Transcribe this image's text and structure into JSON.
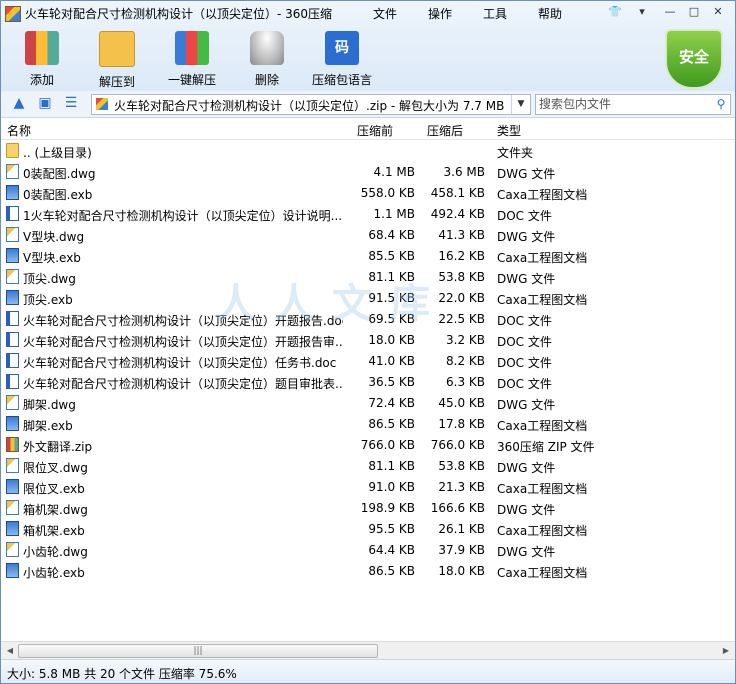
{
  "window": {
    "title": "火车轮对配合尺寸检测机构设计（以顶尖定位）- 360压缩",
    "menu": [
      "文件",
      "操作",
      "工具",
      "帮助"
    ]
  },
  "toolbar": {
    "add_label": "添加",
    "extract_label": "解压到",
    "one_click_label": "一键解压",
    "delete_label": "删除",
    "lang_label": "压缩包语言",
    "lang_glyph": "码"
  },
  "security_label": "安全",
  "navbar": {
    "path": "火车轮对配合尺寸检测机构设计（以顶尖定位）.zip - 解包大小为 7.7 MB",
    "search_placeholder": "搜索包内文件"
  },
  "columns": {
    "name": "名称",
    "compressed": "压缩前",
    "packed": "压缩后",
    "type": "类型"
  },
  "files": [
    {
      "name": ".. (上级目录)",
      "size": "",
      "packed": "",
      "type": "文件夹",
      "icon": "folder"
    },
    {
      "name": "0装配图.dwg",
      "size": "4.1 MB",
      "packed": "3.6 MB",
      "type": "DWG 文件",
      "icon": "dwg"
    },
    {
      "name": "0装配图.exb",
      "size": "558.0 KB",
      "packed": "458.1 KB",
      "type": "Caxa工程图文档",
      "icon": "exb"
    },
    {
      "name": "1火车轮对配合尺寸检测机构设计（以顶尖定位）设计说明...",
      "size": "1.1 MB",
      "packed": "492.4 KB",
      "type": "DOC 文件",
      "icon": "doc"
    },
    {
      "name": "V型块.dwg",
      "size": "68.4 KB",
      "packed": "41.3 KB",
      "type": "DWG 文件",
      "icon": "dwg"
    },
    {
      "name": "V型块.exb",
      "size": "85.5 KB",
      "packed": "16.2 KB",
      "type": "Caxa工程图文档",
      "icon": "exb"
    },
    {
      "name": "顶尖.dwg",
      "size": "81.1 KB",
      "packed": "53.8 KB",
      "type": "DWG 文件",
      "icon": "dwg"
    },
    {
      "name": "顶尖.exb",
      "size": "91.5 KB",
      "packed": "22.0 KB",
      "type": "Caxa工程图文档",
      "icon": "exb"
    },
    {
      "name": "火车轮对配合尺寸检测机构设计（以顶尖定位）开题报告.doc",
      "size": "69.5 KB",
      "packed": "22.5 KB",
      "type": "DOC 文件",
      "icon": "doc"
    },
    {
      "name": "火车轮对配合尺寸检测机构设计（以顶尖定位）开题报告审...",
      "size": "18.0 KB",
      "packed": "3.2 KB",
      "type": "DOC 文件",
      "icon": "doc"
    },
    {
      "name": "火车轮对配合尺寸检测机构设计（以顶尖定位）任务书.doc",
      "size": "41.0 KB",
      "packed": "8.2 KB",
      "type": "DOC 文件",
      "icon": "doc"
    },
    {
      "name": "火车轮对配合尺寸检测机构设计（以顶尖定位）题目审批表...",
      "size": "36.5 KB",
      "packed": "6.3 KB",
      "type": "DOC 文件",
      "icon": "doc"
    },
    {
      "name": "脚架.dwg",
      "size": "72.4 KB",
      "packed": "45.0 KB",
      "type": "DWG 文件",
      "icon": "dwg"
    },
    {
      "name": "脚架.exb",
      "size": "86.5 KB",
      "packed": "17.8 KB",
      "type": "Caxa工程图文档",
      "icon": "exb"
    },
    {
      "name": "外文翻译.zip",
      "size": "766.0 KB",
      "packed": "766.0 KB",
      "type": "360压缩 ZIP 文件",
      "icon": "zip"
    },
    {
      "name": "限位叉.dwg",
      "size": "81.1 KB",
      "packed": "53.8 KB",
      "type": "DWG 文件",
      "icon": "dwg"
    },
    {
      "name": "限位叉.exb",
      "size": "91.0 KB",
      "packed": "21.3 KB",
      "type": "Caxa工程图文档",
      "icon": "exb"
    },
    {
      "name": "箱机架.dwg",
      "size": "198.9 KB",
      "packed": "166.6 KB",
      "type": "DWG 文件",
      "icon": "dwg"
    },
    {
      "name": "箱机架.exb",
      "size": "95.5 KB",
      "packed": "26.1 KB",
      "type": "Caxa工程图文档",
      "icon": "exb"
    },
    {
      "name": "小齿轮.dwg",
      "size": "64.4 KB",
      "packed": "37.9 KB",
      "type": "DWG 文件",
      "icon": "dwg"
    },
    {
      "name": "小齿轮.exb",
      "size": "86.5 KB",
      "packed": "18.0 KB",
      "type": "Caxa工程图文档",
      "icon": "exb"
    }
  ],
  "status": "大小: 5.8 MB 共 20 个文件 压缩率 75.6%",
  "watermark": "人人文库"
}
